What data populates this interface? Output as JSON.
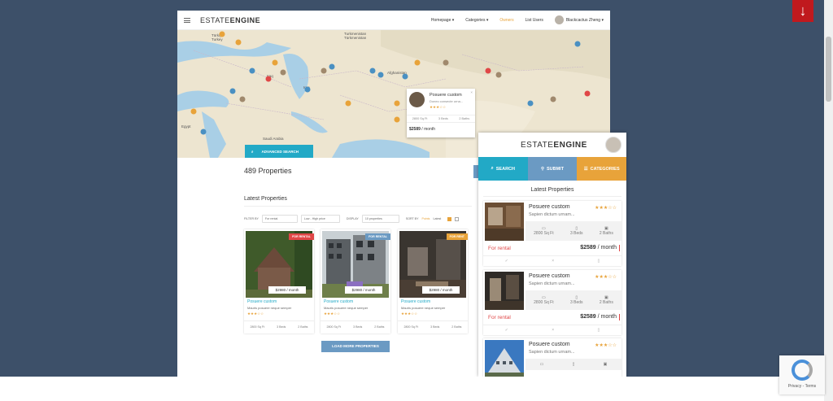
{
  "nav": {
    "logo_light": "ESTATE",
    "logo_bold": "ENGINE",
    "links": [
      "Homepage",
      "Categories",
      "Owners",
      "List Users"
    ],
    "user": "Blackcactus Zheng"
  },
  "map": {
    "labels": [
      "Türkiye",
      "Turkey",
      "Turkmenistan",
      "Türkmenistan",
      "Afghanistan",
      "Iraq",
      "Iran",
      "Egypt",
      "Saudi Arabia"
    ],
    "search_label": "ADVANCED SEARCH"
  },
  "popup": {
    "title": "Posuere custom",
    "subtitle": "Donec consecte urna...",
    "stars": "★★★☆☆",
    "area": "2800 Sq Ft",
    "beds": "3 Beds",
    "baths": "2 Baths",
    "price": "$2589",
    "period": "/ month"
  },
  "listing": {
    "count": "489 Properties",
    "heading": "Latest Properties",
    "filter_label": "FILTER BY",
    "filter_value": "For rental",
    "price_order": "Low - High price",
    "display_label": "DISPLAY",
    "display_value": "10 properties",
    "sort_label": "SORT BY",
    "sort_active": "Points",
    "sort_other": "Latest",
    "load_more": "LOAD MORE PROPERTIES"
  },
  "cards": [
    {
      "tag": "FOR RENTAL",
      "tag_color": "#e04747",
      "price": "$2980 / month",
      "title": "Posuere custom",
      "sub": "Mauris posuere neque semper",
      "stars": "★★★☆☆",
      "area": "2800 Sq Ft",
      "beds": "3 Beds",
      "baths": "2 Baths"
    },
    {
      "tag": "FOR RENTAL",
      "tag_color": "#6b9ac3",
      "price": "$2980 / month",
      "title": "Posuere custom",
      "sub": "Mauris posuere neque semper",
      "stars": "★★★☆☆",
      "area": "2800 Sq Ft",
      "beds": "3 Beds",
      "baths": "2 Baths"
    },
    {
      "tag": "FOR RENT",
      "tag_color": "#e8a33a",
      "price": "$2980 / month",
      "title": "Posuere custom",
      "sub": "Mauris posuere neque semper",
      "stars": "★★★☆☆",
      "area": "2800 Sq Ft",
      "beds": "3 Beds",
      "baths": "2 Baths"
    }
  ],
  "mobile": {
    "logo_light": "ESTATE",
    "logo_bold": "ENGINE",
    "buttons": [
      {
        "label": "SEARCH",
        "color": "#22a9c6"
      },
      {
        "label": "SUBMIT",
        "color": "#6b9ac3"
      },
      {
        "label": "CATEGORIES",
        "color": "#e8a33a"
      }
    ],
    "heading": "Latest Properties",
    "items": [
      {
        "title": "Posuere custom",
        "sub": "Sapien dictum urnam...",
        "stars": "★★★☆☆",
        "area": "2800 Sq Ft",
        "beds": "3 Beds",
        "baths": "2 Baths",
        "status": "For rental",
        "price": "$2589",
        "period": "/ month"
      },
      {
        "title": "Posuere custom",
        "sub": "Sapien dictum urnam...",
        "stars": "★★★☆☆",
        "area": "2800 Sq Ft",
        "beds": "3 Beds",
        "baths": "2 Baths",
        "status": "For rental",
        "price": "$2589",
        "period": "/ month"
      },
      {
        "title": "Posuere custom",
        "sub": "Sapien dictum urnam...",
        "stars": "★★★☆☆"
      }
    ]
  },
  "captcha": {
    "privacy": "Privacy",
    "sep": " - ",
    "terms": "Terms"
  },
  "scroll_arrow": "↓"
}
